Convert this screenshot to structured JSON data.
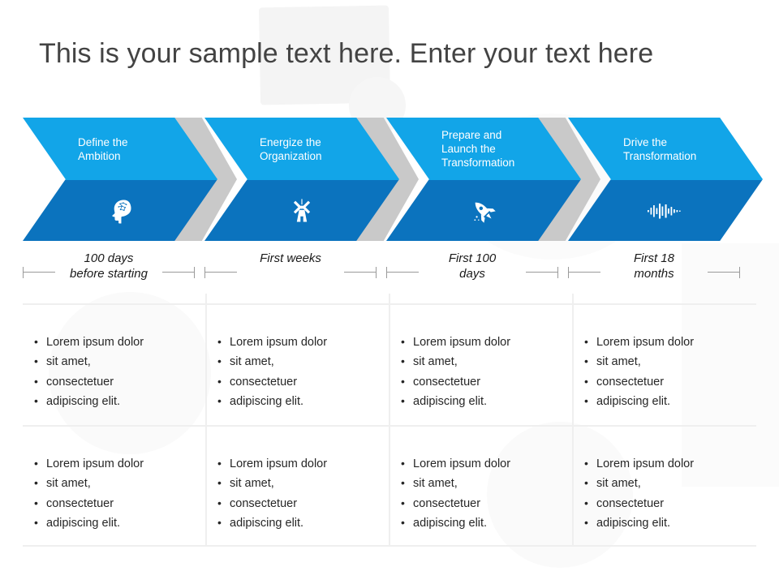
{
  "title": "This is your sample text here. Enter your text here",
  "colors": {
    "chevron_top": "#12a5e8",
    "chevron_bottom": "#0b73be",
    "chevron_separator": "#c9c9c9",
    "title_text": "#434343",
    "body_text": "#262626",
    "grid_line": "#efefef",
    "dimension_line": "#9a9a9a"
  },
  "stages": [
    {
      "title_line1": "Define the",
      "title_line2": "Ambition",
      "title_line3": "",
      "icon": "brain-head-icon",
      "timeline_line1": "100 days",
      "timeline_line2": "before starting"
    },
    {
      "title_line1": "Energize the",
      "title_line2": "Organization",
      "title_line3": "",
      "icon": "windmill-icon",
      "timeline_line1": "First weeks",
      "timeline_line2": ""
    },
    {
      "title_line1": "Prepare and",
      "title_line2": "Launch the",
      "title_line3": "Transformation",
      "icon": "rocket-icon",
      "timeline_line1": "First 100",
      "timeline_line2": "days"
    },
    {
      "title_line1": "Drive the",
      "title_line2": "Transformation",
      "title_line3": "",
      "icon": "sound-wave-icon",
      "timeline_line1": "First 18",
      "timeline_line2": "months"
    }
  ],
  "bullets": {
    "items": [
      "Lorem ipsum dolor",
      "sit amet,",
      "consectetuer",
      "adipiscing elit."
    ]
  }
}
